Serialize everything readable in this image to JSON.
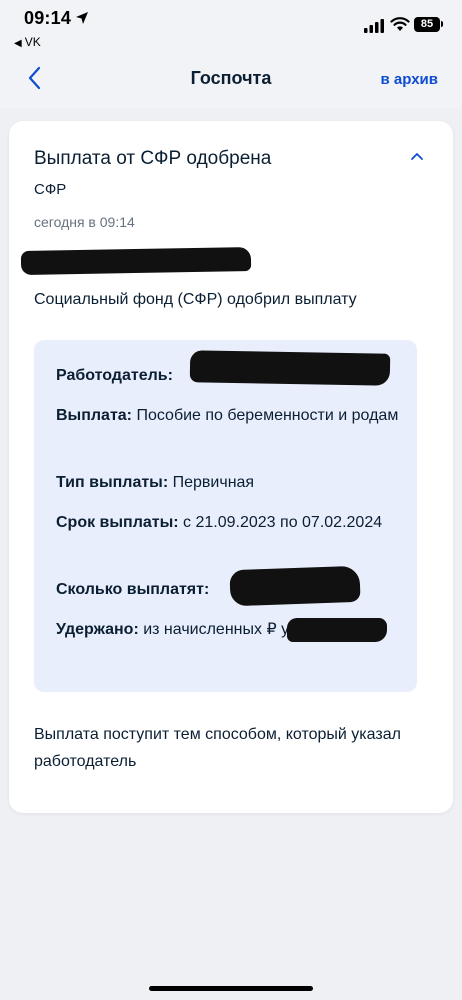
{
  "status_bar": {
    "time": "09:14",
    "back_app": "VK",
    "battery": "85"
  },
  "nav": {
    "title": "Госпочта",
    "archive_label": "в архив"
  },
  "message": {
    "title": "Выплата от СФР одобрена",
    "sender": "СФР",
    "date": "сегодня в 09:14",
    "summary": "Социальный фонд (СФР) одобрил выплату",
    "details": [
      {
        "label": "Работодатель:",
        "value": ""
      },
      {
        "label": "Выплата:",
        "value": " Пособие по беременности и родам"
      },
      {
        "label": "Тип выплаты:",
        "value": " Первичная"
      },
      {
        "label": "Срок выплаты:",
        "value": " с 21.09.2023 по 07.02.2024"
      },
      {
        "label": "Сколько выплатят:",
        "value": ""
      },
      {
        "label": "Удержано:",
        "value": " из начисленных ₽ удержано 0 ₽"
      }
    ],
    "footer": "Выплата поступит тем способом, который указал работодатель"
  }
}
